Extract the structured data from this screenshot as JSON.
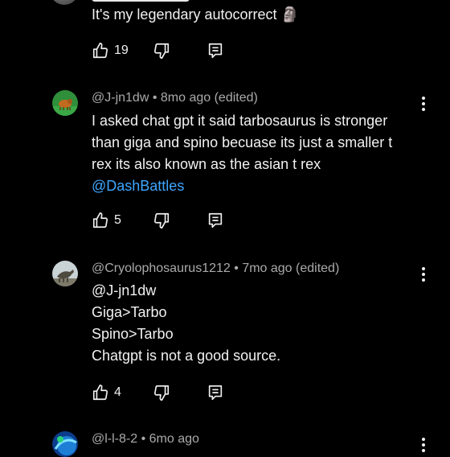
{
  "top_comment": {
    "text": "It's my legendary autocorrect",
    "emoji": "🗿",
    "likes": "19"
  },
  "comments": [
    {
      "handle": "@J-jn1dw",
      "time": "8mo ago (edited)",
      "lines": [
        "I asked chat gpt it said tarbosaurus is stronger",
        "than giga and spino becuase its just a smaller t",
        "rex its also known as the asian t rex"
      ],
      "mention": "@DashBattles",
      "likes": "5"
    },
    {
      "handle": "@Cryolophosaurus1212",
      "time": "7mo ago (edited)",
      "lines": [
        "@J-jn1dw",
        "Giga>Tarbo",
        "Spino>Tarbo",
        "Chatgpt is not a good source."
      ],
      "likes": "4"
    },
    {
      "handle": "@l-l-8-2",
      "time": "6mo ago"
    }
  ],
  "separator": "•"
}
